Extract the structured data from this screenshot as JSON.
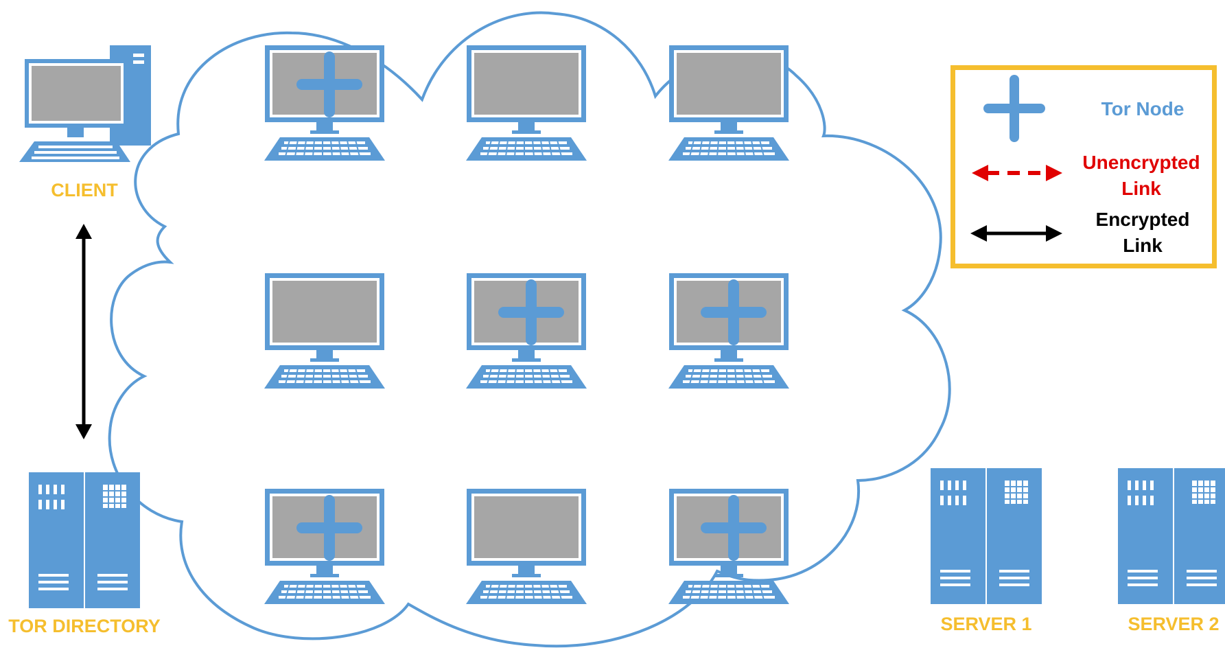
{
  "labels": {
    "client": "CLIENT",
    "tor_directory": "TOR DIRECTORY",
    "server1": "SERVER 1",
    "server2": "SERVER 2"
  },
  "legend": {
    "tor_node": "Tor Node",
    "unencrypted_line1": "Unencrypted",
    "unencrypted_line2": "Link",
    "encrypted_line1": "Encrypted",
    "encrypted_line2": "Link"
  },
  "nodes": [
    {
      "tor": true
    },
    {
      "tor": false
    },
    {
      "tor": false
    },
    {
      "tor": false
    },
    {
      "tor": true
    },
    {
      "tor": true
    },
    {
      "tor": true
    },
    {
      "tor": false
    },
    {
      "tor": true
    }
  ],
  "colors": {
    "blue": "#5b9bd5",
    "gray": "#a6a6a6",
    "orange": "#f5be2e",
    "red": "#e00000",
    "tor_node_text": "#5b9bd5"
  },
  "icons": {
    "client": "desktop-computer-icon",
    "node": "monitor-keyboard-icon",
    "tor_node": "plus-icon",
    "server": "server-rack-icon"
  }
}
